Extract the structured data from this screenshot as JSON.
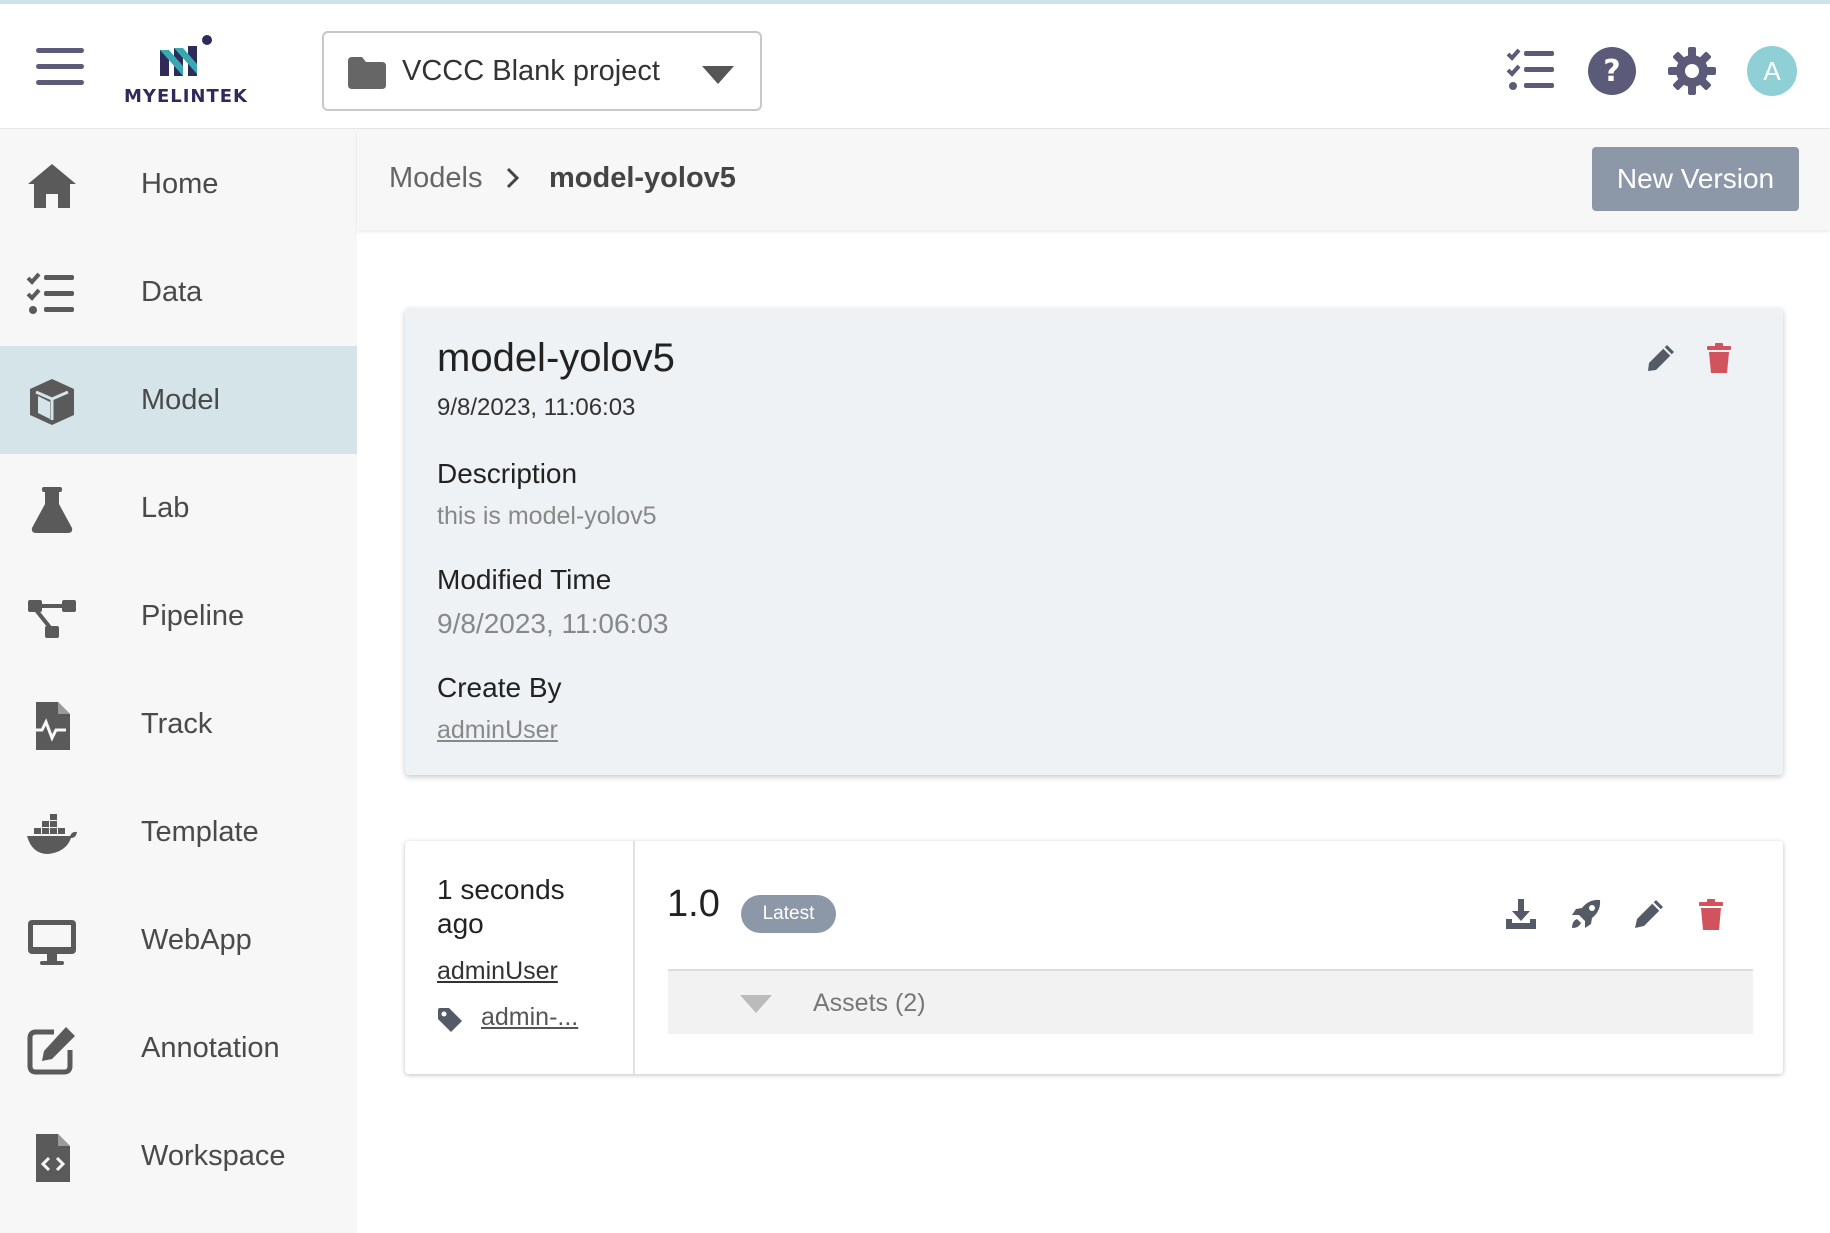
{
  "header": {
    "logo_text": "MyelinTek",
    "project_selector": {
      "label": "VCCC Blank project"
    },
    "avatar_initial": "A"
  },
  "sidebar": {
    "items": [
      {
        "label": "Home",
        "icon": "home-icon",
        "active": false
      },
      {
        "label": "Data",
        "icon": "list-check-icon",
        "active": false
      },
      {
        "label": "Model",
        "icon": "cube-icon",
        "active": true
      },
      {
        "label": "Lab",
        "icon": "flask-icon",
        "active": false
      },
      {
        "label": "Pipeline",
        "icon": "pipeline-icon",
        "active": false
      },
      {
        "label": "Track",
        "icon": "file-pulse-icon",
        "active": false
      },
      {
        "label": "Template",
        "icon": "docker-icon",
        "active": false
      },
      {
        "label": "WebApp",
        "icon": "desktop-icon",
        "active": false
      },
      {
        "label": "Annotation",
        "icon": "edit-square-icon",
        "active": false
      },
      {
        "label": "Workspace",
        "icon": "file-code-icon",
        "active": false
      }
    ]
  },
  "breadcrumb": {
    "root": "Models",
    "current": "model-yolov5"
  },
  "actions": {
    "new_version": "New Version"
  },
  "model": {
    "name": "model-yolov5",
    "created": "9/8/2023, 11:06:03",
    "description_label": "Description",
    "description": "this is model-yolov5",
    "modified_label": "Modified Time",
    "modified": "9/8/2023, 11:06:03",
    "created_by_label": "Create By",
    "created_by": "adminUser"
  },
  "version": {
    "ago": "1 seconds ago",
    "user": "adminUser",
    "tag": "admin-...",
    "number": "1.0",
    "badge": "Latest",
    "assets_label": "Assets (2)"
  },
  "colors": {
    "brand_purple": "#5b5a78",
    "accent_teal": "#8fcfd6",
    "active_nav": "#d4e4e9",
    "button_gray": "#8c98a8",
    "delete_red": "#d0535e"
  }
}
